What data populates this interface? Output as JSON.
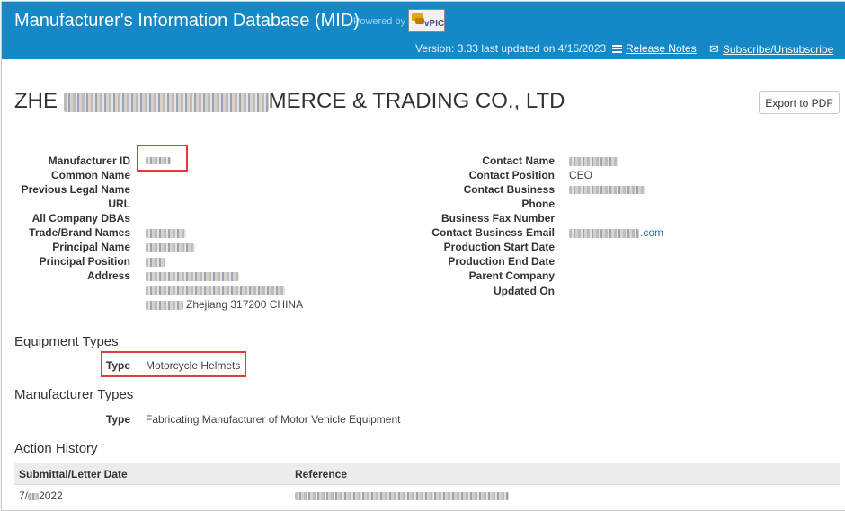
{
  "header": {
    "title": "Manufacturer's Information Database (MID)",
    "powered_by": "Powered by",
    "logo_text": "vPIC",
    "version": "Version: 3.33 last updated on 4/15/2023",
    "release_notes": "Release Notes",
    "subscribe": "Subscribe/Unsubscribe",
    "color": "#1588c8"
  },
  "company": {
    "name_prefix": "ZHE",
    "name_suffix": "MERCE & TRADING CO., LTD"
  },
  "export_button": "Export to PDF",
  "left_fields": [
    {
      "label": "Manufacturer ID",
      "value": ""
    },
    {
      "label": "Common Name",
      "value": ""
    },
    {
      "label": "Previous Legal Name",
      "value": ""
    },
    {
      "label": "URL",
      "value": ""
    },
    {
      "label": "All Company DBAs",
      "value": ""
    },
    {
      "label": "Trade/Brand Names",
      "value": ""
    },
    {
      "label": "Principal Name",
      "value": ""
    },
    {
      "label": "Principal Position",
      "value": ""
    },
    {
      "label": "Address",
      "value": ""
    }
  ],
  "address_line3_suffix": "Zhejiang 317200 CHINA",
  "right_fields": [
    {
      "label": "Contact Name",
      "value": ""
    },
    {
      "label": "Contact Position",
      "value": "CEO"
    },
    {
      "label": "Contact Business",
      "value": ""
    },
    {
      "label": "Phone",
      "value": ""
    },
    {
      "label": "Business Fax Number",
      "value": ""
    },
    {
      "label": "Contact Business Email",
      "value": ".com"
    },
    {
      "label": "Production Start Date",
      "value": ""
    },
    {
      "label": "Production End Date",
      "value": ""
    },
    {
      "label": "Parent Company",
      "value": ""
    },
    {
      "label": "Updated On",
      "value": ""
    }
  ],
  "equipment": {
    "title": "Equipment Types",
    "type_label": "Type",
    "type_value": "Motorcycle Helmets"
  },
  "manufacturer_types": {
    "title": "Manufacturer Types",
    "type_label": "Type",
    "type_value": "Fabricating Manufacturer of Motor Vehicle Equipment"
  },
  "action_history": {
    "title": "Action History",
    "columns": [
      "Submittal/Letter Date",
      "Reference"
    ],
    "rows": [
      {
        "date_prefix": "7/",
        "date_suffix": "2022"
      }
    ]
  },
  "highlight_color": "#e03c3c"
}
